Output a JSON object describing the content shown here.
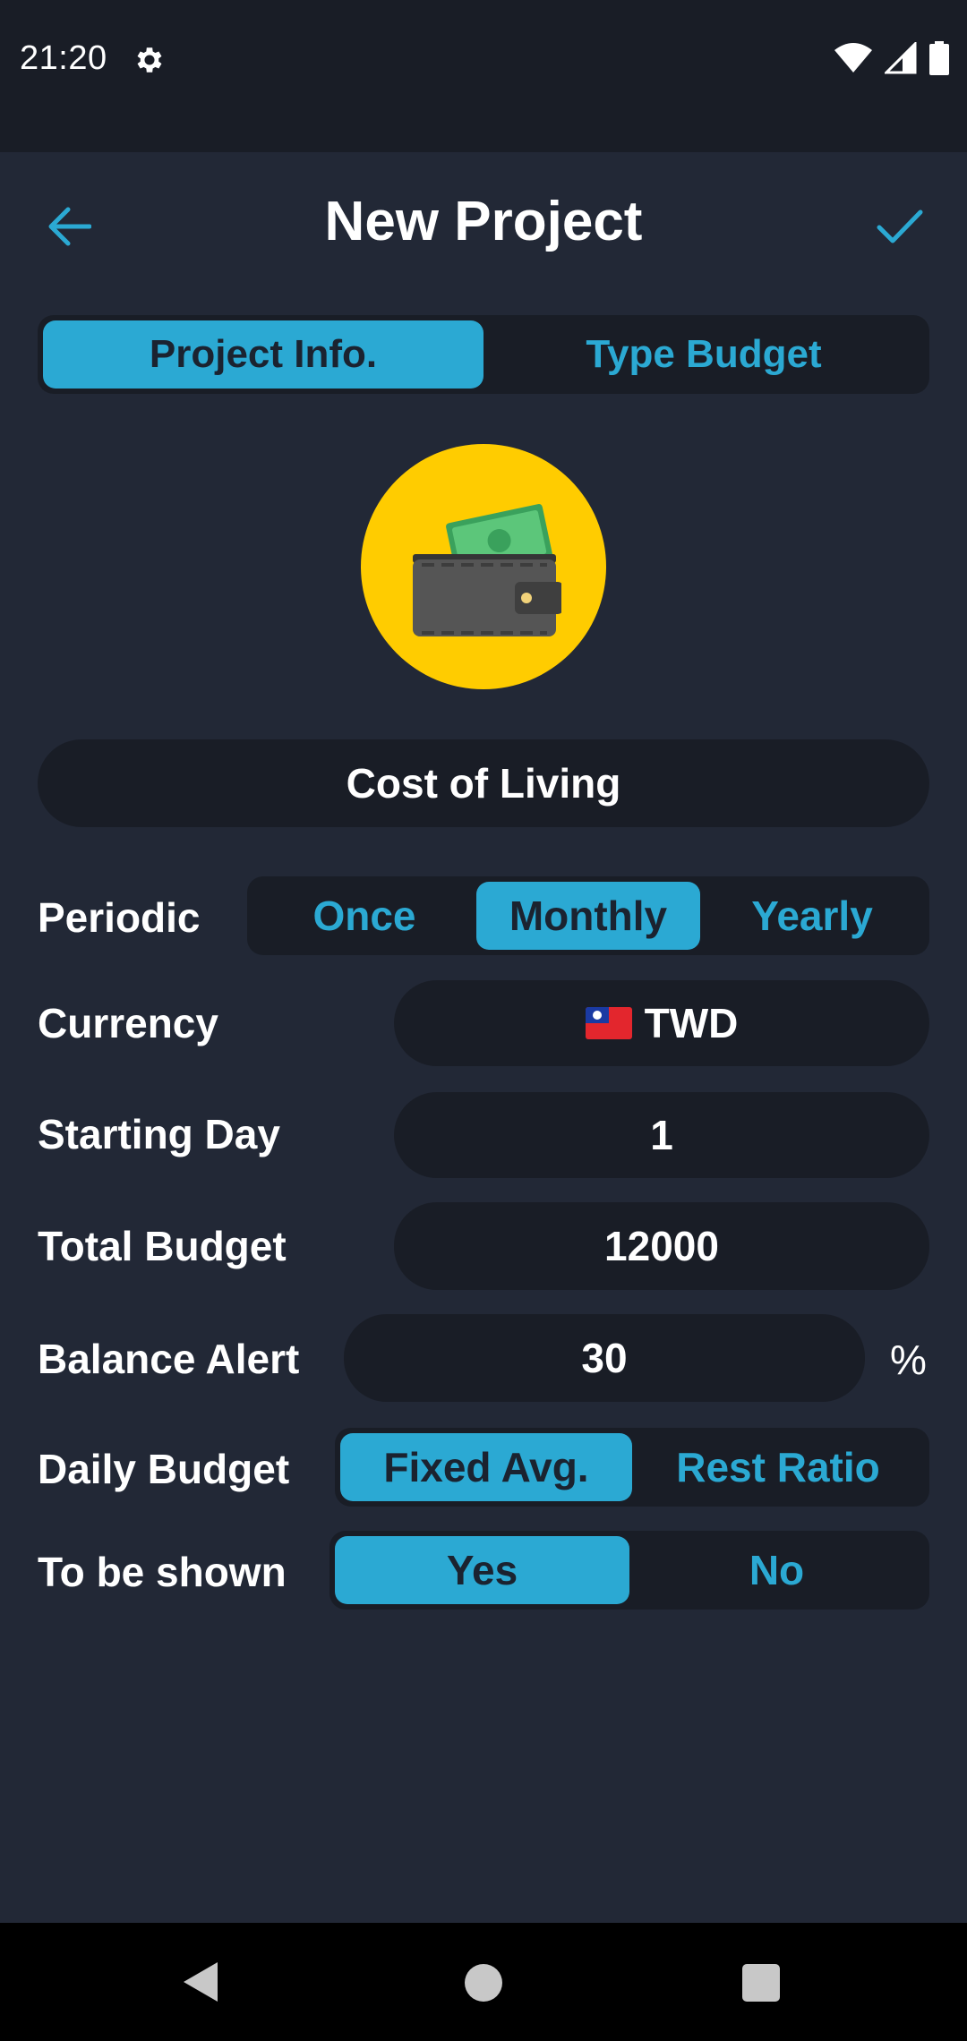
{
  "status_bar": {
    "time": "21:20"
  },
  "header": {
    "title": "New Project"
  },
  "tabs": [
    {
      "label": "Project Info.",
      "active": true
    },
    {
      "label": "Type Budget",
      "active": false
    }
  ],
  "project": {
    "icon": "wallet-icon",
    "name": "Cost of Living"
  },
  "form": {
    "periodic": {
      "label": "Periodic",
      "options": [
        "Once",
        "Monthly",
        "Yearly"
      ],
      "selected": "Monthly"
    },
    "currency": {
      "label": "Currency",
      "value": "TWD",
      "flag_icon": "taiwan-flag-icon"
    },
    "starting_day": {
      "label": "Starting Day",
      "value": "1"
    },
    "total_budget": {
      "label": "Total Budget",
      "value": "12000"
    },
    "balance_alert": {
      "label": "Balance Alert",
      "value": "30",
      "unit": "%"
    },
    "daily_budget": {
      "label": "Daily Budget",
      "options": [
        "Fixed Avg.",
        "Rest Ratio"
      ],
      "selected": "Fixed Avg."
    },
    "to_be_shown": {
      "label": "To be shown",
      "options": [
        "Yes",
        "No"
      ],
      "selected": "Yes"
    }
  },
  "colors": {
    "background": "#222836",
    "field": "#191d26",
    "accent": "#2ba9d3",
    "avatar_bg": "#ffcc00"
  }
}
